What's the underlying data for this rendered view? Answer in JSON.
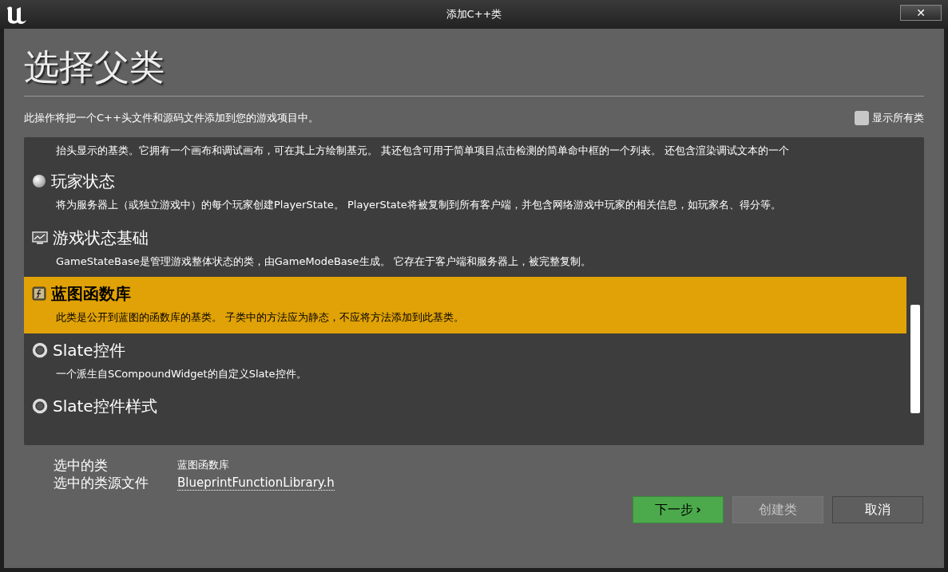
{
  "window": {
    "title": "添加C++类",
    "close": "✕"
  },
  "heading": "选择父类",
  "intro": "此操作将把一个C++头文件和源码文件添加到您的游戏项目中。",
  "show_all": {
    "label": "显示所有类",
    "checked": false
  },
  "list": {
    "top_fragment": "抬头显示的基类。它拥有一个画布和调试画布，可在其上方绘制基元。 其还包含可用于简单项目点击检测的简单命中框的一个列表。 还包含渲染调试文本的一个",
    "items": [
      {
        "kind": "sphere",
        "title": "玩家状态",
        "description": "将为服务器上（或独立游戏中）的每个玩家创建PlayerState。 PlayerState将被复制到所有客户端，并包含网络游戏中玩家的相关信息，如玩家名、得分等。",
        "selected": false
      },
      {
        "kind": "monitor",
        "title": "游戏状态基础",
        "description": "GameStateBase是管理游戏整体状态的类，由GameModeBase生成。 它存在于客户端和服务器上，被完整复制。",
        "selected": false
      },
      {
        "kind": "function",
        "title": "蓝图函数库",
        "description": "此类是公开到蓝图的函数库的基类。 子类中的方法应为静态，不应将方法添加到此基类。",
        "selected": true
      },
      {
        "kind": "ring",
        "title": "Slate控件",
        "description": "一个派生自SCompoundWidget的自定义Slate控件。",
        "selected": false
      },
      {
        "kind": "ring",
        "title": "Slate控件样式",
        "selected": false
      }
    ]
  },
  "selection": {
    "class_label": "选中的类",
    "class_value": "蓝图函数库",
    "file_label": "选中的类源文件",
    "file_value": "BlueprintFunctionLibrary.h"
  },
  "buttons": [
    {
      "label": "下一步",
      "kind": "primary",
      "disabled": false,
      "chevron": "›"
    },
    {
      "label": "创建类",
      "kind": "normal",
      "disabled": true
    },
    {
      "label": "取消",
      "kind": "normal",
      "disabled": false
    }
  ]
}
